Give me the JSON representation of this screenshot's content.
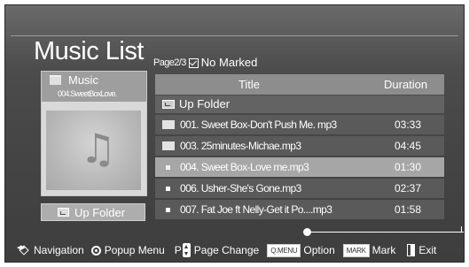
{
  "header": {
    "title": "Music List",
    "page": "Page2/3",
    "marked_status": "No Marked"
  },
  "left_panel": {
    "folder_label": "Music",
    "file_name": "004.SweetBoxLove.",
    "art_icon": "music-note-icon",
    "up_folder_button": "Up Folder"
  },
  "table": {
    "col_title": "Title",
    "col_duration": "Duration",
    "up_folder_row": "Up Folder",
    "rows": [
      {
        "name": "001. Sweet Box-Don't Push Me. mp3",
        "duration": "03:33",
        "type": "folder",
        "selected": false
      },
      {
        "name": "003. 25minutes-Michae.mp3",
        "duration": "04:45",
        "type": "folder",
        "selected": false
      },
      {
        "name": "004. Sweet Box-Love me.mp3",
        "duration": "01:30",
        "type": "file",
        "selected": true
      },
      {
        "name": "006. Usher-She's Gone.mp3",
        "duration": "02:37",
        "type": "file",
        "selected": false
      },
      {
        "name": "007. Fat Joe ft Nelly-Get it Po....mp3",
        "duration": "01:58",
        "type": "file",
        "selected": false
      }
    ]
  },
  "footer": {
    "navigation": "Navigation",
    "popup_menu": "Popup Menu",
    "p_label": "P",
    "page_change": "Page Change",
    "qmenu_key": "Q.MENU",
    "option": "Option",
    "mark_key": "MARK",
    "mark": "Mark",
    "exit": "Exit"
  },
  "colors": {
    "background_top": "#6a6a6a",
    "background_bottom": "#3e3e3e",
    "selected_row": "#a6a6a6",
    "row": "#5a5a5a",
    "header_row": "#8d8d8d"
  }
}
